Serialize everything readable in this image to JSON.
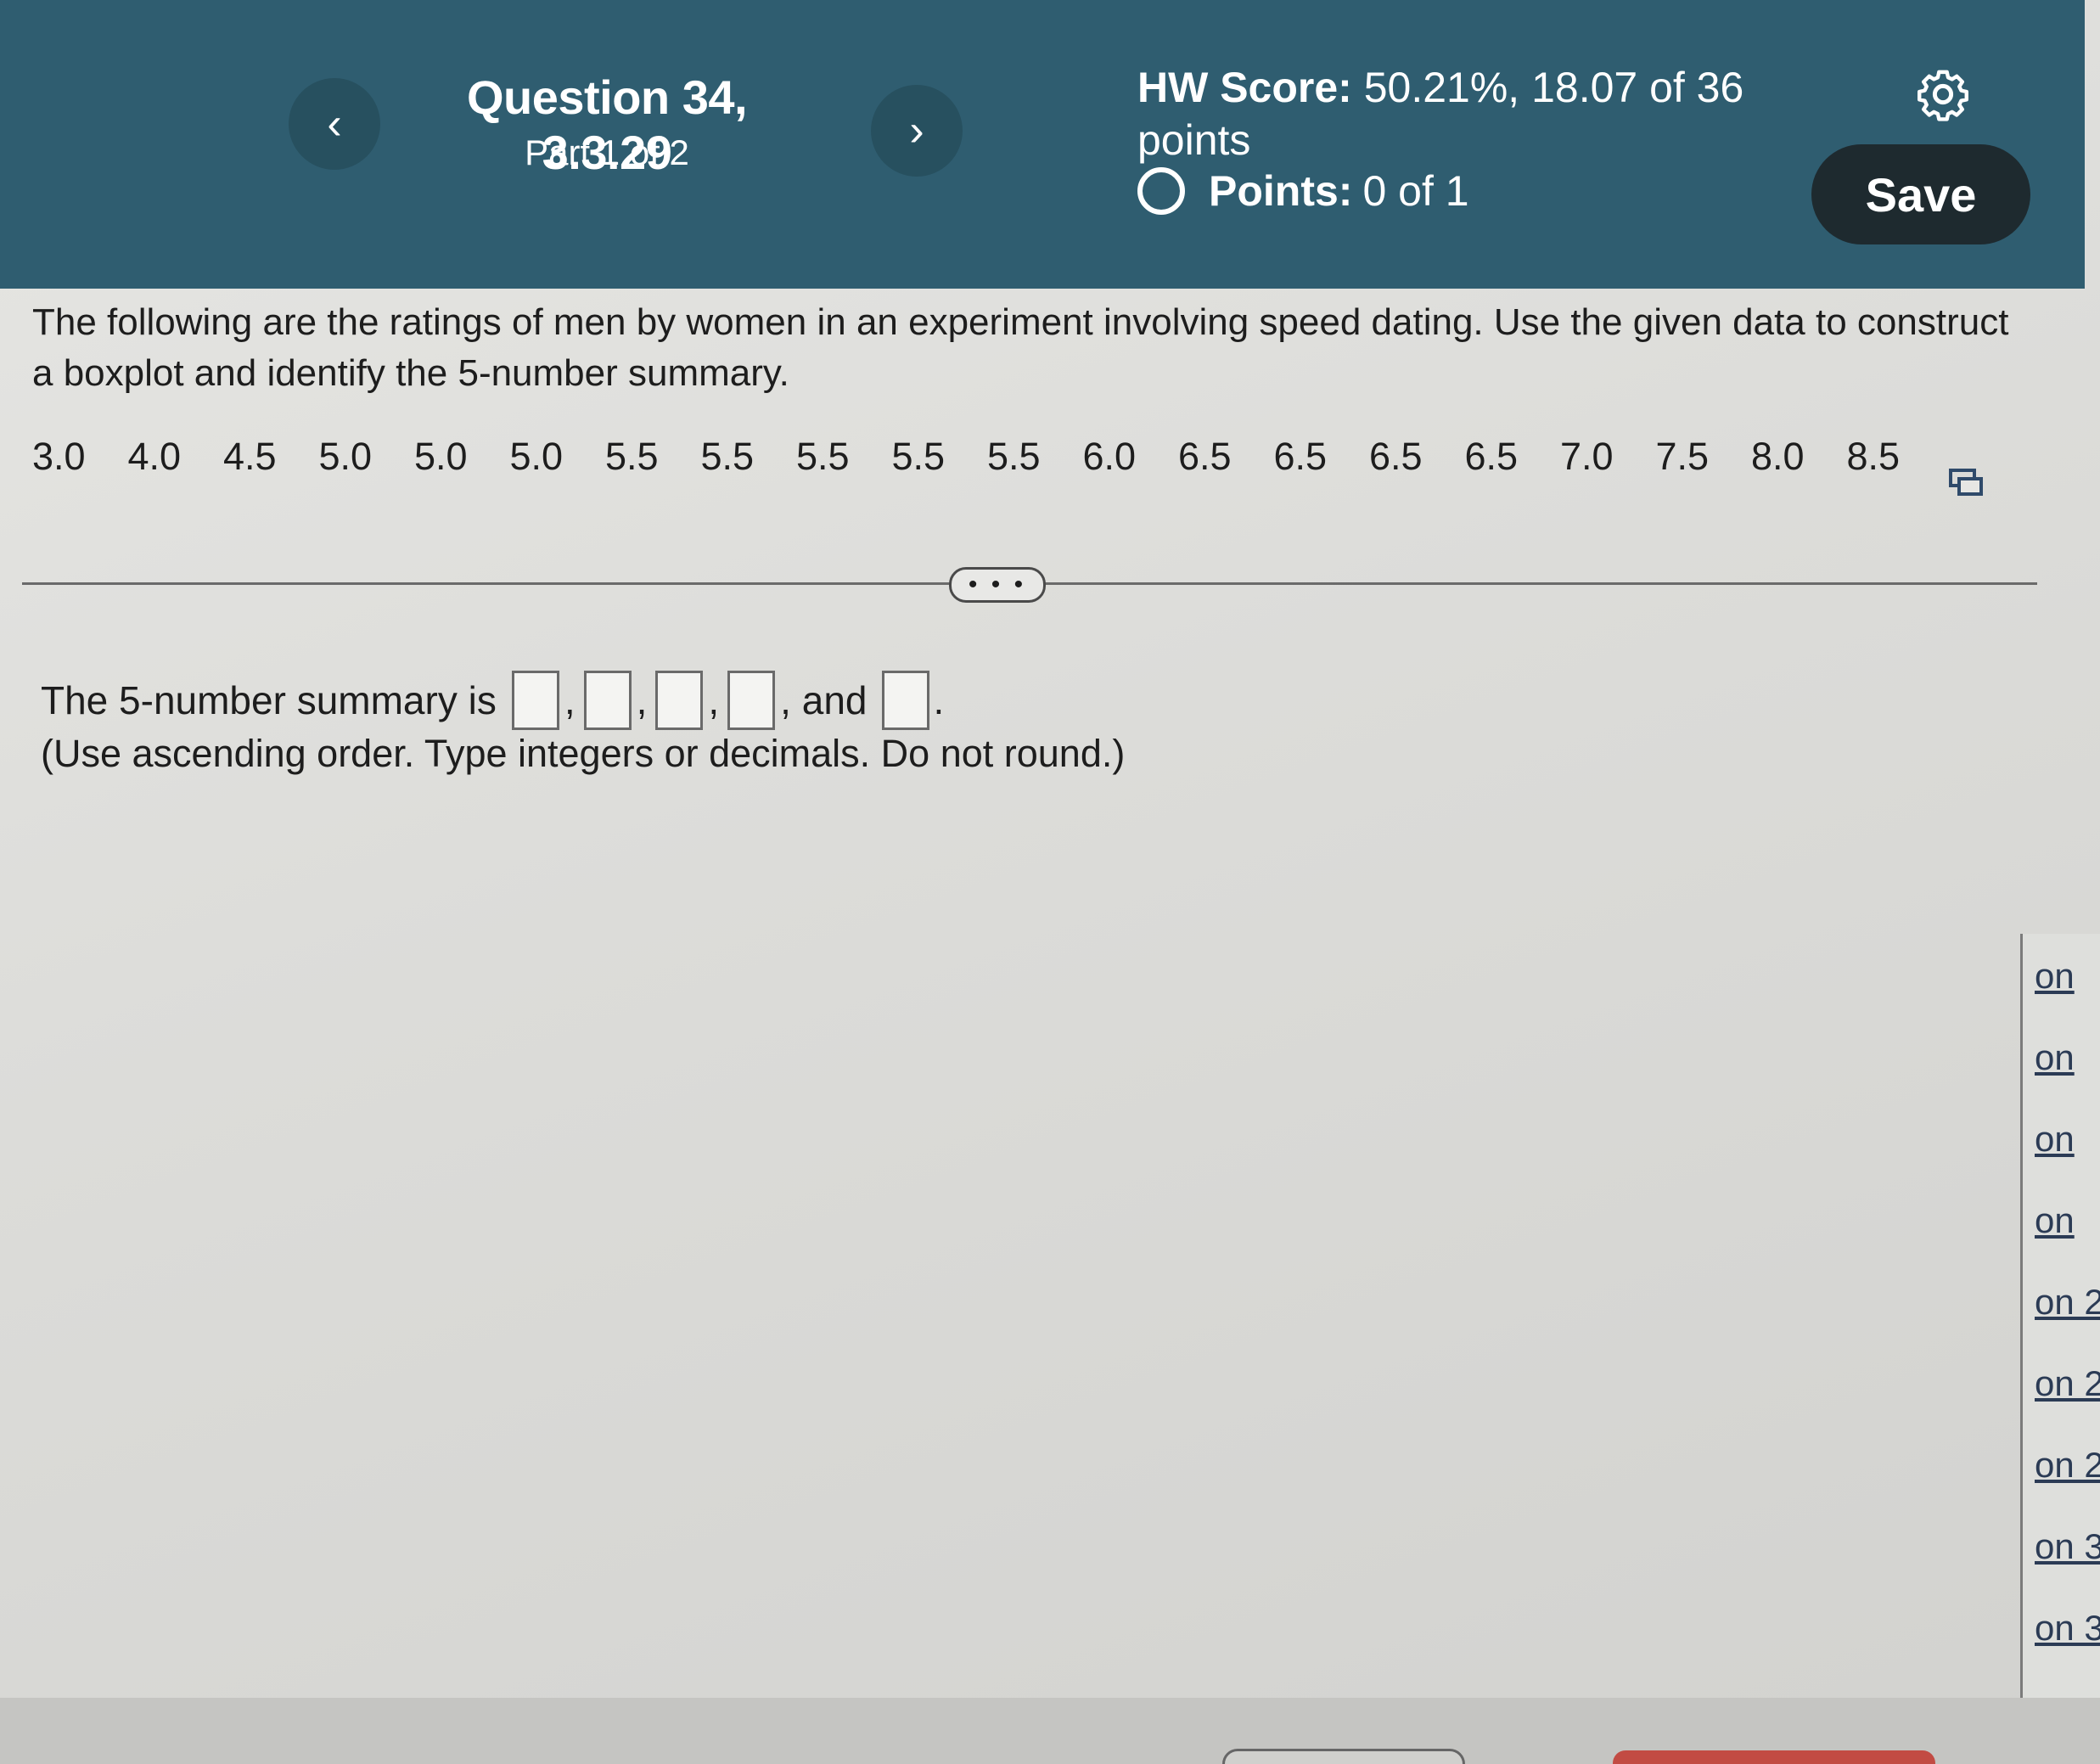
{
  "header": {
    "prev_icon": "chevron-left-icon",
    "prev_symbol": "‹",
    "next_icon": "chevron-right-icon",
    "next_symbol": "›",
    "question_title": "Question 34, 3.3.29",
    "question_part": "Part 1 of 2",
    "hw_score_label": "HW Score:",
    "hw_score_value": "50.21%, 18.07 of 36 points",
    "points_label": "Points:",
    "points_value": "0 of 1",
    "settings_icon": "gear-icon",
    "save_label": "Save",
    "header_color": "#2f5d70"
  },
  "problem": {
    "text": "The following are the ratings of men by women in an experiment involving speed dating. Use the given data to construct a boxplot and identify the 5-number summary.",
    "data": [
      "3.0",
      "4.0",
      "4.5",
      "5.0",
      "5.0",
      "5.0",
      "5.5",
      "5.5",
      "5.5",
      "5.5",
      "5.5",
      "6.0",
      "6.5",
      "6.5",
      "6.5",
      "6.5",
      "7.0",
      "7.5",
      "8.0",
      "8.5"
    ],
    "copy_icon": "copy-icon",
    "expand_label": "• • •"
  },
  "answer": {
    "prefix": "The 5-number summary is",
    "comma": ",",
    "and_label": ", and",
    "period": ".",
    "box_values": [
      "",
      "",
      "",
      "",
      ""
    ],
    "hint": "(Use ascending order. Type integers or decimals. Do not round.)"
  },
  "side_list": [
    "on",
    "on",
    "on",
    "on",
    "on 2",
    "on 2",
    "on 2",
    "on 3",
    "on 3"
  ]
}
